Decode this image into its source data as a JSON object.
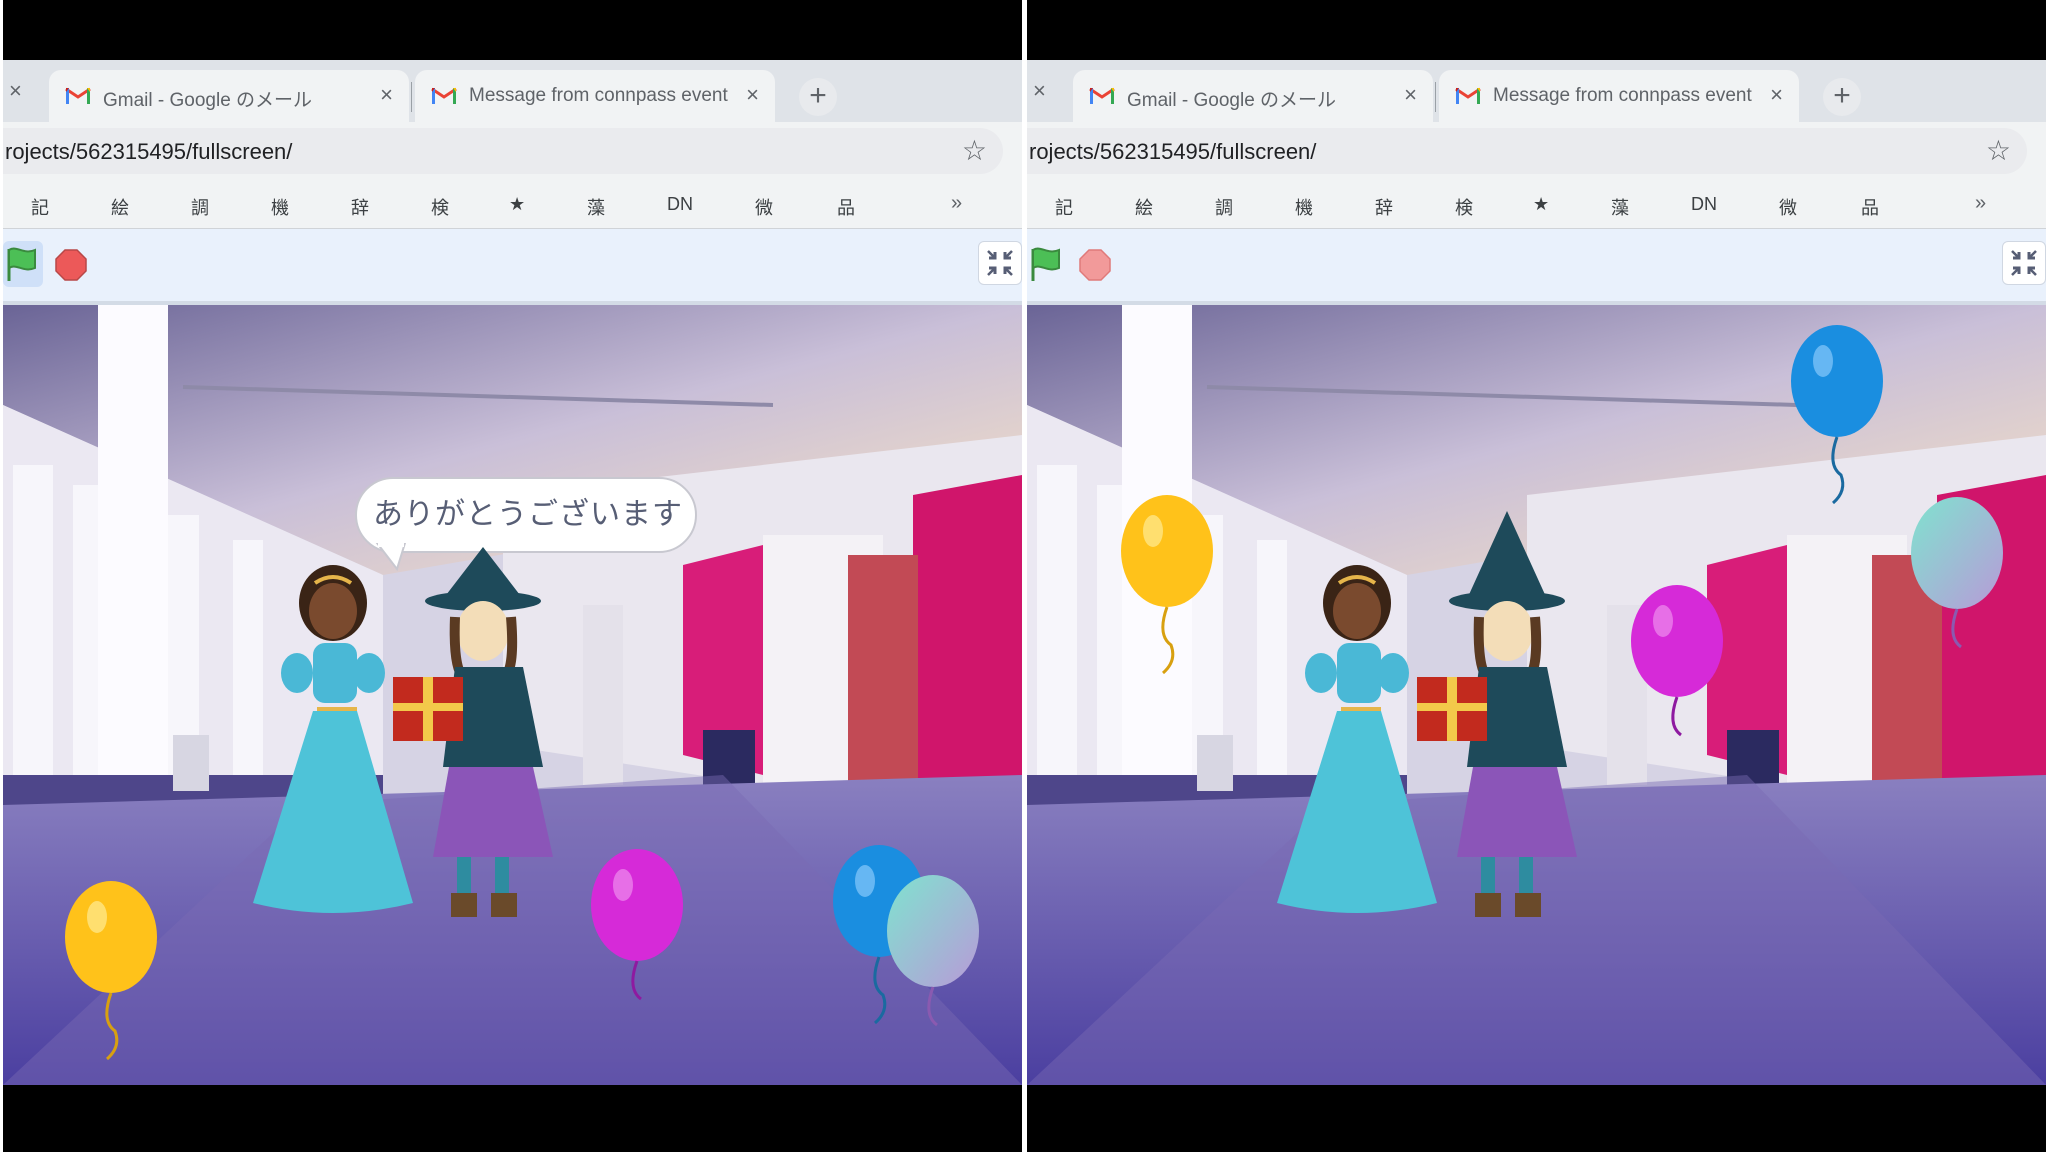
{
  "browser": {
    "tabs": [
      {
        "title": "Gmail - Google のメール",
        "favicon": "gmail-icon"
      },
      {
        "title": "Message from connpass event",
        "favicon": "gmail-icon"
      }
    ],
    "new_tab_label": "+",
    "close_glyph": "×",
    "url": "rojects/562315495/fullscreen/",
    "bookmarks": [
      "記",
      "絵",
      "調",
      "機",
      "辞",
      "検",
      "★",
      "藻",
      "DN",
      "微",
      "品"
    ],
    "bookmarks_overflow": "»"
  },
  "stage_left": {
    "speech": "ありがとうございます",
    "balloons": [
      {
        "color": "yellow",
        "hex": "#ffc21a"
      },
      {
        "color": "magenta",
        "hex": "#d62ad8"
      },
      {
        "color": "blue",
        "hex": "#1a8ee0"
      },
      {
        "color": "teal",
        "hex": "#8fd6d6"
      }
    ]
  },
  "stage_right": {
    "speech": "",
    "balloons": [
      {
        "color": "yellow",
        "hex": "#ffc21a"
      },
      {
        "color": "blue",
        "hex": "#1a8ee0"
      },
      {
        "color": "magenta",
        "hex": "#d62ad8"
      },
      {
        "color": "teal",
        "hex": "#8fd6d6"
      }
    ]
  },
  "controls": {
    "green_flag": "green-flag-icon",
    "stop": "stop-icon",
    "exit_fullscreen": "exit-fullscreen-icon"
  },
  "colors": {
    "scratch_blue": "#e9f1fc",
    "flag_green": "#4cbf56",
    "stop_red": "#ec5959",
    "wall_magenta": "#d0156b"
  }
}
